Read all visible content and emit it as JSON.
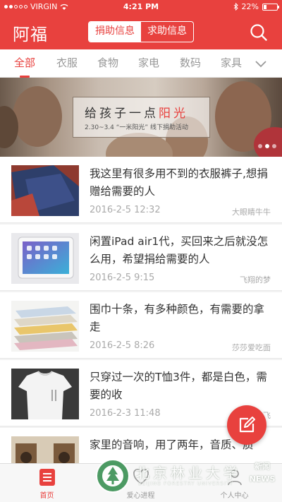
{
  "status_bar": {
    "carrier": "VIRGIN",
    "time": "4:21 PM",
    "battery": "22%"
  },
  "header": {
    "logo": "阿福",
    "segments": [
      "捐助信息",
      "求助信息"
    ],
    "active_segment": 0
  },
  "tabs": {
    "items": [
      "全部",
      "衣服",
      "食物",
      "家电",
      "数码",
      "家具"
    ],
    "active": 0
  },
  "banner": {
    "title_prefix": "给孩子一点",
    "title_highlight": "阳光",
    "subtitle": "2.30~3.4 “一米阳光” 线下捐助活动",
    "slide_count": 3,
    "active_slide": 1
  },
  "posts": [
    {
      "title": "我这里有很多用不到的衣服裤子,想捐赠给需要的人",
      "date": "2016-2-5 12:32",
      "user": "大眼睛牛牛"
    },
    {
      "title": "闲置iPad air1代，买回来之后就没怎么用，希望捐给需要的人",
      "date": "2016-2-5 9:15",
      "user": "飞翔的梦"
    },
    {
      "title": "围巾十条，有多种颜色，有需要的拿走",
      "date": "2016-2-5 8:26",
      "user": "莎莎爱吃面"
    },
    {
      "title": "只穿过一次的T恤3件，都是白色，需要的收",
      "date": "2016-2-3 11:48",
      "user": "飞"
    },
    {
      "title": "家里的音响，用了两年，音质、质",
      "date": "",
      "user": ""
    }
  ],
  "bottom_nav": {
    "items": [
      "首页",
      "爱心进程",
      "个人中心"
    ],
    "active": 0
  },
  "watermark": {
    "name": "北京林业大学",
    "english": "BEIJING FORESTRY UNIVERSITY",
    "tag": "新闻 NEWS"
  },
  "colors": {
    "accent": "#e8413e",
    "muted_text": "#aaaaaa",
    "body_text": "#333333"
  }
}
